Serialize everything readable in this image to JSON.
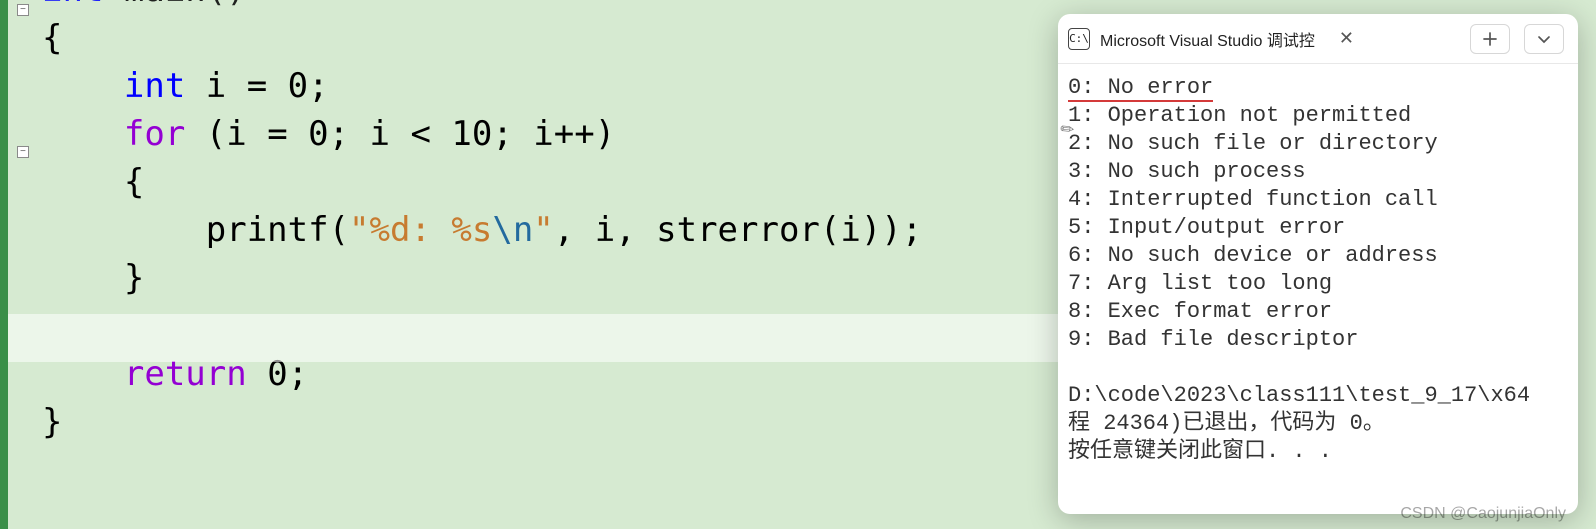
{
  "editor": {
    "code_lines": [
      {
        "segs": [
          {
            "t": "int",
            "cls": "kw-blue"
          },
          {
            "t": " main()",
            "cls": ""
          }
        ]
      },
      {
        "segs": [
          {
            "t": "{",
            "cls": ""
          }
        ]
      },
      {
        "segs": [
          {
            "t": "    ",
            "cls": ""
          },
          {
            "t": "int",
            "cls": "kw-blue"
          },
          {
            "t": " i = 0;",
            "cls": ""
          }
        ]
      },
      {
        "segs": [
          {
            "t": "    ",
            "cls": ""
          },
          {
            "t": "for",
            "cls": "kw-purple"
          },
          {
            "t": " (i = 0; i < 10; i++)",
            "cls": ""
          }
        ]
      },
      {
        "segs": [
          {
            "t": "    {",
            "cls": ""
          }
        ]
      },
      {
        "segs": [
          {
            "t": "        printf(",
            "cls": ""
          },
          {
            "t": "\"%d: %s",
            "cls": "string"
          },
          {
            "t": "\\n",
            "cls": "escape"
          },
          {
            "t": "\"",
            "cls": "string"
          },
          {
            "t": ", i, strerror(i));",
            "cls": ""
          }
        ]
      },
      {
        "segs": [
          {
            "t": "    }",
            "cls": ""
          }
        ]
      },
      {
        "segs": [
          {
            "t": " ",
            "cls": ""
          }
        ]
      },
      {
        "segs": [
          {
            "t": "    ",
            "cls": ""
          },
          {
            "t": "return",
            "cls": "kw-purple"
          },
          {
            "t": " 0;",
            "cls": ""
          }
        ]
      },
      {
        "segs": [
          {
            "t": "}",
            "cls": ""
          }
        ]
      }
    ],
    "first_line_cut": true
  },
  "console": {
    "tab_title": "Microsoft Visual Studio 调试控",
    "tab_icon_text": "C:\\",
    "output_lines": [
      "0: No error",
      "1: Operation not permitted",
      "2: No such file or directory",
      "3: No such process",
      "4: Interrupted function call",
      "5: Input/output error",
      "6: No such device or address",
      "7: Arg list too long",
      "8: Exec format error",
      "9: Bad file descriptor",
      "",
      "D:\\code\\2023\\class111\\test_9_17\\x64",
      "程 24364)已退出，代码为 0。",
      "按任意键关闭此窗口. . ."
    ]
  },
  "watermark": "CSDN @CaojunjiaOnly"
}
